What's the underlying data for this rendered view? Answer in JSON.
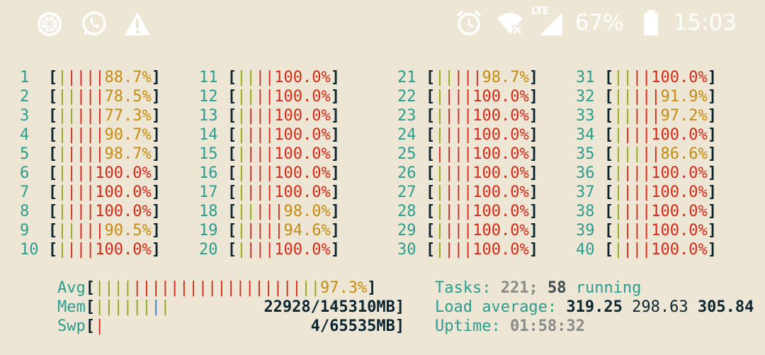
{
  "status_bar": {
    "left_icons": [
      "lemon-icon",
      "whatsapp-icon",
      "warning-icon"
    ],
    "alarm_icon": "alarm-icon",
    "wifi_icon": "wifi-off-icon",
    "signal_label": "LTE",
    "battery_text": "67%",
    "time": "15:03"
  },
  "cpus_left": [
    {
      "n": "1",
      "pct": "88.7%",
      "g": 1,
      "r": 4
    },
    {
      "n": "2",
      "pct": "78.5%",
      "g": 2,
      "r": 3
    },
    {
      "n": "3",
      "pct": "77.3%",
      "g": 2,
      "r": 3
    },
    {
      "n": "4",
      "pct": "90.7%",
      "g": 1,
      "r": 4
    },
    {
      "n": "5",
      "pct": "98.7%",
      "g": 1,
      "r": 4
    },
    {
      "n": "6",
      "pct": "100.0%",
      "g": 1,
      "r": 3
    },
    {
      "n": "7",
      "pct": "100.0%",
      "g": 1,
      "r": 3
    },
    {
      "n": "8",
      "pct": "100.0%",
      "g": 1,
      "r": 3
    },
    {
      "n": "9",
      "pct": "90.5%",
      "g": 2,
      "r": 3
    },
    {
      "n": "10",
      "pct": "100.0%",
      "g": 1,
      "r": 3
    },
    {
      "n": "11",
      "pct": "100.0%",
      "g": 2,
      "r": 2
    },
    {
      "n": "12",
      "pct": "100.0%",
      "g": 2,
      "r": 2
    },
    {
      "n": "13",
      "pct": "100.0%",
      "g": 1,
      "r": 3
    },
    {
      "n": "14",
      "pct": "100.0%",
      "g": 1,
      "r": 3
    },
    {
      "n": "15",
      "pct": "100.0%",
      "g": 1,
      "r": 3
    },
    {
      "n": "16",
      "pct": "100.0%",
      "g": 1,
      "r": 3
    },
    {
      "n": "17",
      "pct": "100.0%",
      "g": 1,
      "r": 3
    },
    {
      "n": "18",
      "pct": "98.0%",
      "g": 2,
      "r": 3
    },
    {
      "n": "19",
      "pct": "94.6%",
      "g": 1,
      "r": 4
    },
    {
      "n": "20",
      "pct": "100.0%",
      "g": 1,
      "r": 3
    }
  ],
  "cpus_right": [
    {
      "n": "21",
      "pct": "98.7%",
      "g": 2,
      "r": 3
    },
    {
      "n": "22",
      "pct": "100.0%",
      "g": 1,
      "r": 3
    },
    {
      "n": "23",
      "pct": "100.0%",
      "g": 1,
      "r": 3
    },
    {
      "n": "24",
      "pct": "100.0%",
      "g": 1,
      "r": 3
    },
    {
      "n": "25",
      "pct": "100.0%",
      "g": 0,
      "r": 4
    },
    {
      "n": "26",
      "pct": "100.0%",
      "g": 1,
      "r": 3
    },
    {
      "n": "27",
      "pct": "100.0%",
      "g": 1,
      "r": 3
    },
    {
      "n": "28",
      "pct": "100.0%",
      "g": 1,
      "r": 3
    },
    {
      "n": "29",
      "pct": "100.0%",
      "g": 1,
      "r": 3
    },
    {
      "n": "30",
      "pct": "100.0%",
      "g": 1,
      "r": 3
    },
    {
      "n": "31",
      "pct": "100.0%",
      "g": 2,
      "r": 2
    },
    {
      "n": "32",
      "pct": "91.9%",
      "g": 2,
      "r": 3
    },
    {
      "n": "33",
      "pct": "97.2%",
      "g": 2,
      "r": 3
    },
    {
      "n": "34",
      "pct": "100.0%",
      "g": 1,
      "r": 3
    },
    {
      "n": "35",
      "pct": "86.6%",
      "g": 3,
      "r": 2
    },
    {
      "n": "36",
      "pct": "100.0%",
      "g": 1,
      "r": 3
    },
    {
      "n": "37",
      "pct": "100.0%",
      "g": 1,
      "r": 3
    },
    {
      "n": "38",
      "pct": "100.0%",
      "g": 1,
      "r": 3
    },
    {
      "n": "39",
      "pct": "100.0%",
      "g": 1,
      "r": 3
    },
    {
      "n": "40",
      "pct": "100.0%",
      "g": 1,
      "r": 3
    }
  ],
  "avg": {
    "label": "Avg",
    "pct": "97.3%",
    "g": 4,
    "r": 18
  },
  "mem": {
    "label": "Mem",
    "value": "22928/145310MB",
    "g": 6,
    "b": 1
  },
  "swp": {
    "label": "Swp",
    "value": "4/65535MB",
    "r": 1
  },
  "tasks": {
    "label": "Tasks:",
    "total": "221;",
    "running_count": "58",
    "running_label": "running"
  },
  "load": {
    "label": "Load average:",
    "l1": "319.25",
    "l5": "298.63",
    "l15": "305.84"
  },
  "uptime": {
    "label": "Uptime:",
    "value": "01:58:32"
  },
  "colors": {
    "bg": "#eee6d5",
    "cyan": "#2a9d8f",
    "green": "#8ea81a",
    "red": "#d12a18",
    "amber": "#c48c10",
    "dark": "#0b2530"
  }
}
